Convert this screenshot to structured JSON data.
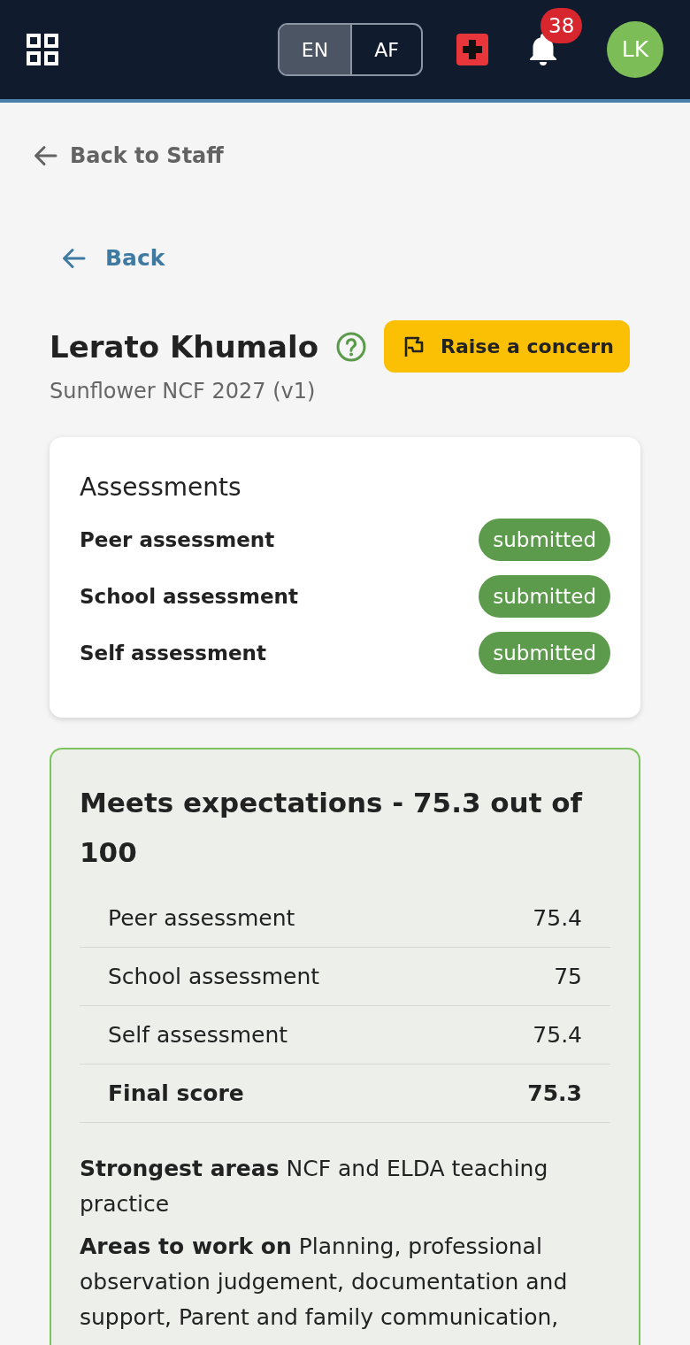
{
  "header": {
    "languages": [
      {
        "label": "EN",
        "selected": true
      },
      {
        "label": "AF",
        "selected": false
      }
    ],
    "notification_count": "38",
    "avatar_initials": "LK"
  },
  "back_to_staff": "Back to Staff",
  "back": "Back",
  "profile": {
    "name": "Lerato Khumalo",
    "concern_button": "Raise a concern",
    "subtitle": "Sunflower NCF 2027 (v1)"
  },
  "assessments": {
    "title": "Assessments",
    "items": [
      {
        "name": "Peer assessment",
        "status": "submitted"
      },
      {
        "name": "School assessment",
        "status": "submitted"
      },
      {
        "name": "Self assessment",
        "status": "submitted"
      }
    ]
  },
  "result": {
    "title": "Meets expectations - 75.3 out of 100",
    "rows": [
      {
        "kind": "score",
        "label": "Peer assessment",
        "value": "75.4"
      },
      {
        "kind": "score",
        "label": "School assessment",
        "value": "75"
      },
      {
        "kind": "score",
        "label": "Self assessment",
        "value": "75.4"
      },
      {
        "kind": "total",
        "label": "Final score",
        "value": "75.3"
      }
    ],
    "summary": [
      "**Strongest areas** NCF and ELDA teaching practice",
      "**Areas to work on** Planning, professional observation judgement, documentation and support, Parent and family communication,"
    ]
  }
}
